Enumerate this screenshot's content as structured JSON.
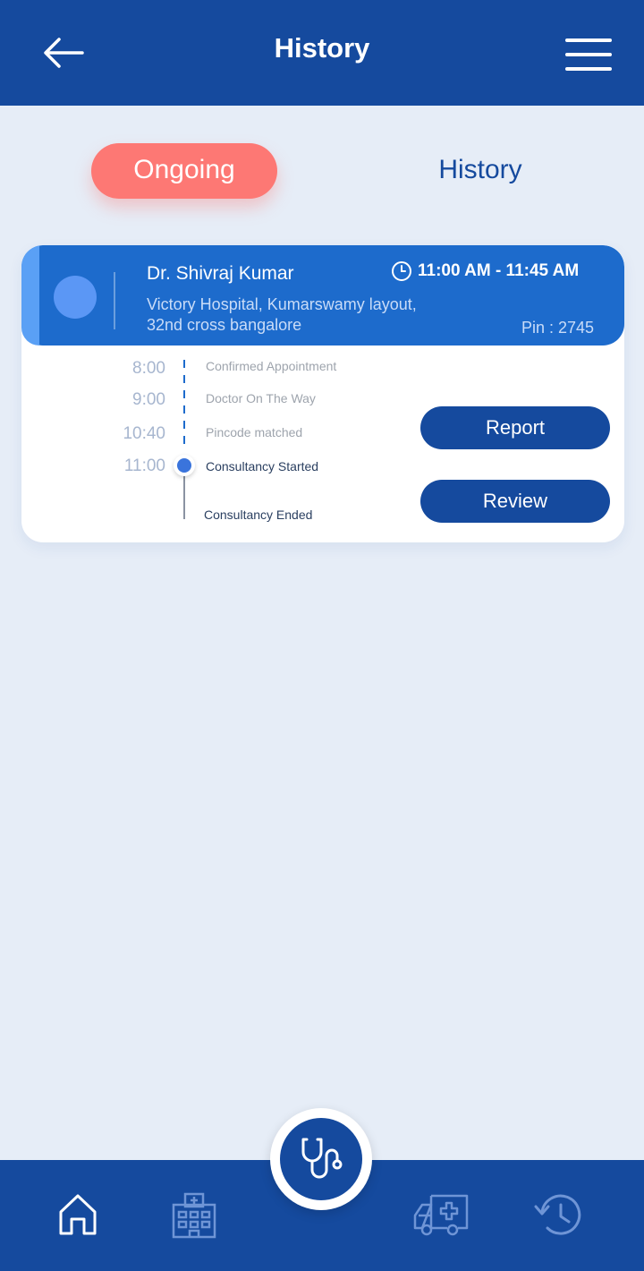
{
  "header": {
    "title": "History"
  },
  "tabs": {
    "ongoing": "Ongoing",
    "history": "History"
  },
  "appointment": {
    "doctor_name": "Dr. Shivraj Kumar",
    "address_line1": "Victory Hospital, Kumarswamy layout,",
    "address_line2": "32nd cross bangalore",
    "time_range": "11:00 AM - 11:45 AM",
    "pin": "Pin : 2745",
    "timeline": [
      {
        "time": "8:00",
        "label": "Confirmed Appointment"
      },
      {
        "time": "9:00",
        "label": "Doctor On The Way"
      },
      {
        "time": "10:40",
        "label": "Pincode matched"
      },
      {
        "time": "11:00",
        "label": "Consultancy Started"
      },
      {
        "time": "",
        "label": "Consultancy Ended"
      }
    ],
    "report_label": "Report",
    "review_label": "Review"
  },
  "colors": {
    "primary": "#154a9e",
    "accent": "#fd7874",
    "card_header": "#1d6bcc",
    "background": "#e6edf7"
  },
  "icons": {
    "back": "arrow-left-icon",
    "menu": "hamburger-icon",
    "clock": "clock-icon",
    "home": "home-icon",
    "hospital": "hospital-icon",
    "consult": "stethoscope-icon",
    "ambulance": "ambulance-icon",
    "history": "history-icon"
  }
}
